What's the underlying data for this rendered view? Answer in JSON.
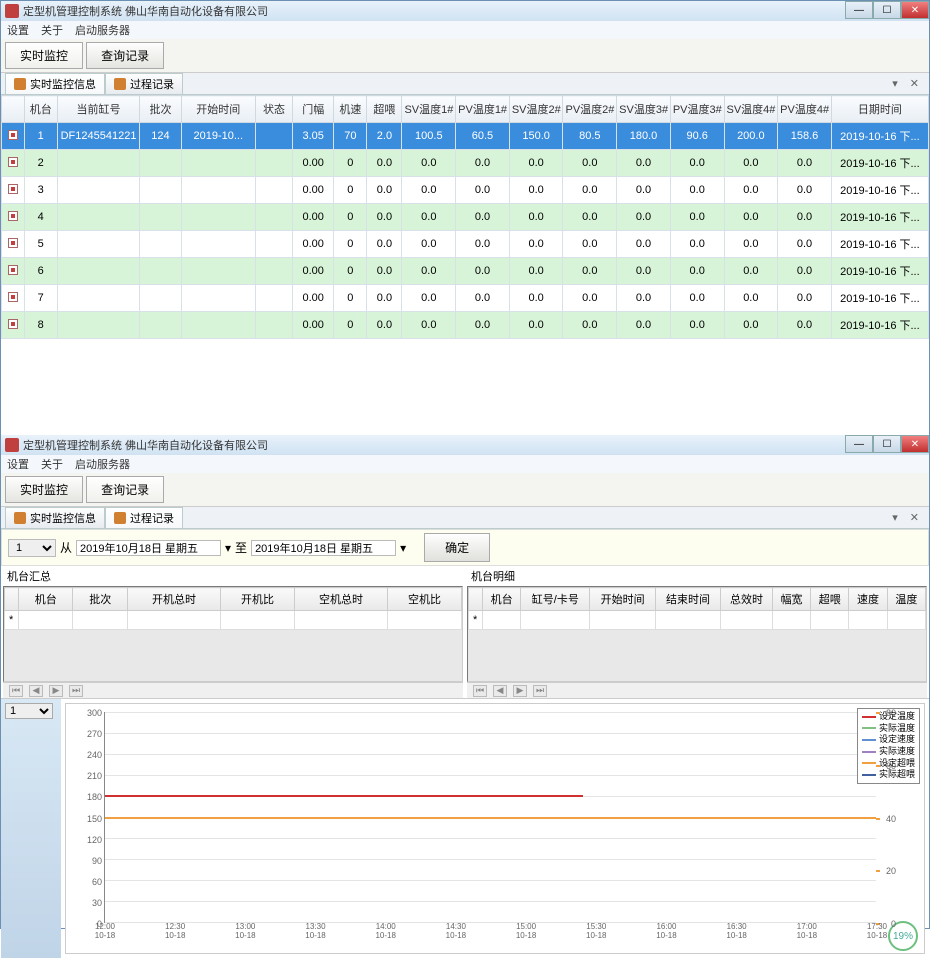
{
  "app": {
    "title": "定型机管理控制系统    佛山华南自动化设备有限公司",
    "menu": [
      "设置",
      "关于",
      "启动服务器"
    ],
    "mainTabs": [
      "实时监控",
      "查询记录"
    ],
    "subTabs": [
      "实时监控信息",
      "过程记录"
    ]
  },
  "winbtns": {
    "min": "—",
    "max": "☐",
    "close": "✕"
  },
  "topGrid": {
    "columns": [
      "",
      "机台",
      "当前缸号",
      "批次",
      "开始时间",
      "状态",
      "门幅",
      "机速",
      "超喂",
      "SV温度1#",
      "PV温度1#",
      "SV温度2#",
      "PV温度2#",
      "SV温度3#",
      "PV温度3#",
      "SV温度4#",
      "PV温度4#",
      "日期时间"
    ],
    "widths": [
      22,
      32,
      80,
      40,
      72,
      36,
      40,
      32,
      34,
      52,
      52,
      52,
      52,
      52,
      52,
      52,
      52,
      94
    ],
    "rows": [
      {
        "sel": true,
        "c": [
          "1",
          "DF1245541221",
          "124",
          "2019-10...",
          "",
          "3.05",
          "70",
          "2.0",
          "100.5",
          "60.5",
          "150.0",
          "80.5",
          "180.0",
          "90.6",
          "200.0",
          "158.6",
          "2019-10-16 下..."
        ]
      },
      {
        "sel": false,
        "c": [
          "2",
          "",
          "",
          "",
          "",
          "0.00",
          "0",
          "0.0",
          "0.0",
          "0.0",
          "0.0",
          "0.0",
          "0.0",
          "0.0",
          "0.0",
          "0.0",
          "2019-10-16 下..."
        ]
      },
      {
        "sel": false,
        "c": [
          "3",
          "",
          "",
          "",
          "",
          "0.00",
          "0",
          "0.0",
          "0.0",
          "0.0",
          "0.0",
          "0.0",
          "0.0",
          "0.0",
          "0.0",
          "0.0",
          "2019-10-16 下..."
        ]
      },
      {
        "sel": false,
        "c": [
          "4",
          "",
          "",
          "",
          "",
          "0.00",
          "0",
          "0.0",
          "0.0",
          "0.0",
          "0.0",
          "0.0",
          "0.0",
          "0.0",
          "0.0",
          "0.0",
          "2019-10-16 下..."
        ]
      },
      {
        "sel": false,
        "c": [
          "5",
          "",
          "",
          "",
          "",
          "0.00",
          "0",
          "0.0",
          "0.0",
          "0.0",
          "0.0",
          "0.0",
          "0.0",
          "0.0",
          "0.0",
          "0.0",
          "2019-10-16 下..."
        ]
      },
      {
        "sel": false,
        "c": [
          "6",
          "",
          "",
          "",
          "",
          "0.00",
          "0",
          "0.0",
          "0.0",
          "0.0",
          "0.0",
          "0.0",
          "0.0",
          "0.0",
          "0.0",
          "0.0",
          "2019-10-16 下..."
        ]
      },
      {
        "sel": false,
        "c": [
          "7",
          "",
          "",
          "",
          "",
          "0.00",
          "0",
          "0.0",
          "0.0",
          "0.0",
          "0.0",
          "0.0",
          "0.0",
          "0.0",
          "0.0",
          "0.0",
          "2019-10-16 下..."
        ]
      },
      {
        "sel": false,
        "c": [
          "8",
          "",
          "",
          "",
          "",
          "0.00",
          "0",
          "0.0",
          "0.0",
          "0.0",
          "0.0",
          "0.0",
          "0.0",
          "0.0",
          "0.0",
          "0.0",
          "2019-10-16 下..."
        ]
      }
    ]
  },
  "query": {
    "machineSel": "1",
    "fromLabel": "从",
    "toLabel": "至",
    "fromDate": "2019年10月18日 星期五",
    "toDate": "2019年10月18日 星期五",
    "confirm": "确定"
  },
  "panelLeft": {
    "title": "机台汇总",
    "columns": [
      "",
      "机台",
      "批次",
      "开机总时",
      "开机比",
      "空机总时",
      "空机比"
    ]
  },
  "panelRight": {
    "title": "机台明细",
    "columns": [
      "",
      "机台",
      "缸号/卡号",
      "开始时间",
      "结束时间",
      "总效时",
      "幅宽",
      "超喂",
      "速度",
      "温度"
    ]
  },
  "chartSel": "1",
  "chart_data": {
    "type": "line",
    "title": "",
    "ylim_left": [
      0,
      300
    ],
    "ylim_right": [
      0,
      80
    ],
    "yticks_left": [
      0,
      30,
      60,
      90,
      120,
      150,
      180,
      210,
      240,
      270,
      300
    ],
    "yticks_right": [
      0,
      20,
      40,
      60,
      80
    ],
    "x_ticks": [
      {
        "time": "12:00",
        "date": "10-18"
      },
      {
        "time": "12:30",
        "date": "10-18"
      },
      {
        "time": "13:00",
        "date": "10-18"
      },
      {
        "time": "13:30",
        "date": "10-18"
      },
      {
        "time": "14:00",
        "date": "10-18"
      },
      {
        "time": "14:30",
        "date": "10-18"
      },
      {
        "time": "15:00",
        "date": "10-18"
      },
      {
        "time": "15:30",
        "date": "10-18"
      },
      {
        "time": "16:00",
        "date": "10-18"
      },
      {
        "time": "16:30",
        "date": "10-18"
      },
      {
        "time": "17:00",
        "date": "10-18"
      },
      {
        "time": "17:30",
        "date": "10-18"
      }
    ],
    "legend": [
      {
        "name": "设定温度",
        "color": "#d03030"
      },
      {
        "name": "实际温度",
        "color": "#80c080"
      },
      {
        "name": "设定速度",
        "color": "#6090d0"
      },
      {
        "name": "实际速度",
        "color": "#a080c0"
      },
      {
        "name": "设定超喂",
        "color": "#f0a040"
      },
      {
        "name": "实际超喂",
        "color": "#4060a0"
      }
    ],
    "series": [
      {
        "name": "设定温度",
        "axis": "left",
        "value_const": 182,
        "x_extent": [
          0,
          0.62
        ]
      },
      {
        "name": "设定超喂",
        "axis": "right",
        "value_const": 40,
        "x_extent": [
          0,
          1.0
        ]
      }
    ]
  },
  "badge": "19%"
}
